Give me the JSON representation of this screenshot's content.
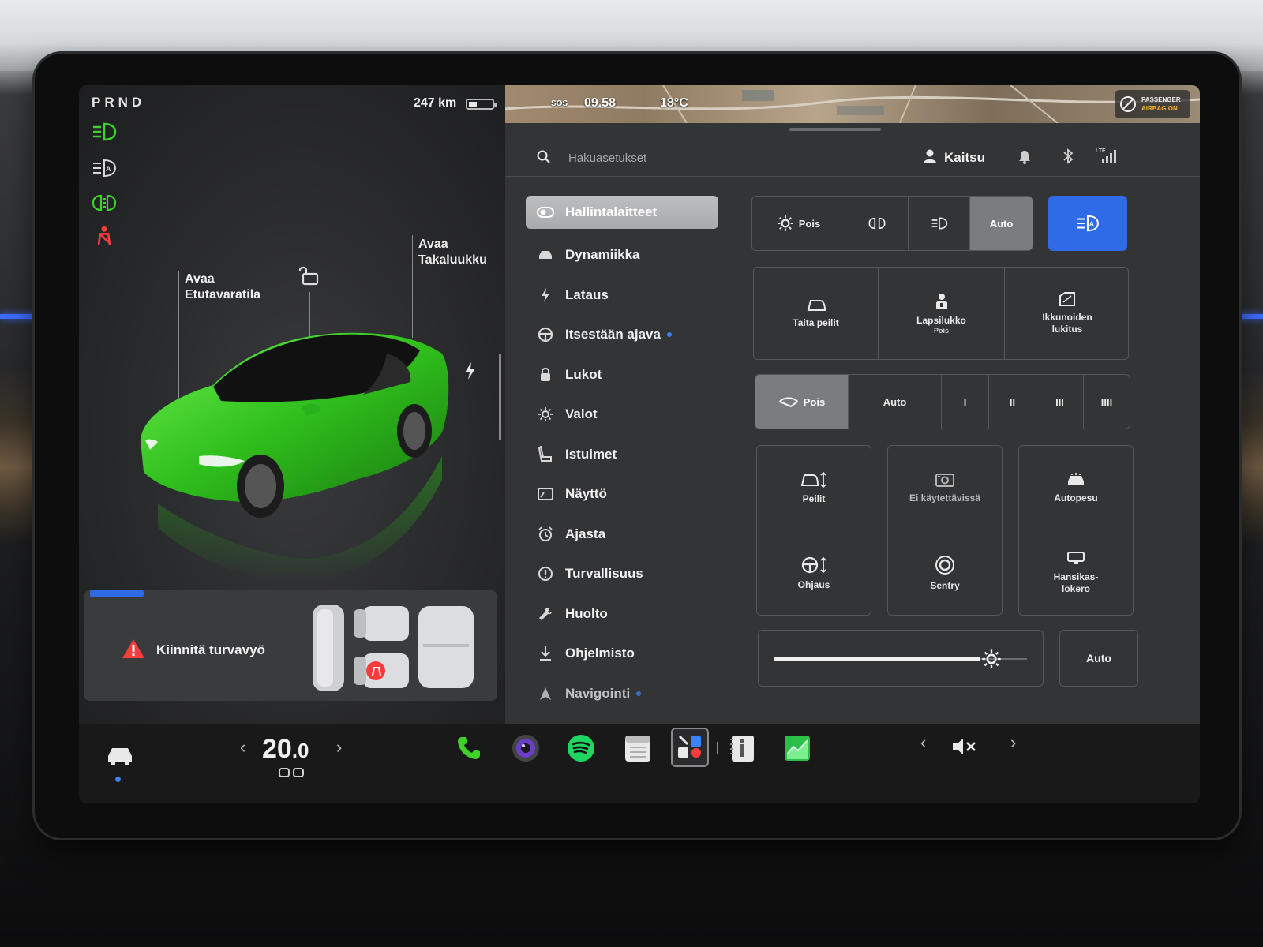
{
  "status": {
    "gear": "PRND",
    "range": "247 km",
    "map_time": "09.58",
    "map_temp": "18°C",
    "map_badge": "SOS",
    "airbag_line1": "PASSENGER",
    "airbag_line2": "AIRBAG ON"
  },
  "car": {
    "frunk_label_1": "Avaa",
    "frunk_label_2": "Etutavaratila",
    "trunk_label_1": "Avaa",
    "trunk_label_2": "Takaluukku",
    "body_color": "#3fd22b"
  },
  "alert": {
    "text": "Kiinnitä turvavyö"
  },
  "topbar": {
    "search_placeholder": "Hakuasetukset",
    "profile_name": "Kaitsu",
    "signal": "LTE"
  },
  "menu": [
    {
      "label": "Hallintalaitteet",
      "icon": "toggle-icon"
    },
    {
      "label": "Dynamiikka",
      "icon": "car-icon"
    },
    {
      "label": "Lataus",
      "icon": "bolt-icon"
    },
    {
      "label": "Itsestään ajava",
      "icon": "steering-wheel-icon"
    },
    {
      "label": "Lukot",
      "icon": "lock-icon"
    },
    {
      "label": "Valot",
      "icon": "sun-icon"
    },
    {
      "label": "Istuimet",
      "icon": "seat-icon"
    },
    {
      "label": "Näyttö",
      "icon": "display-icon"
    },
    {
      "label": "Ajasta",
      "icon": "alarm-clock-icon"
    },
    {
      "label": "Turvallisuus",
      "icon": "info-circle-icon"
    },
    {
      "label": "Huolto",
      "icon": "wrench-icon"
    },
    {
      "label": "Ohjelmisto",
      "icon": "download-icon"
    },
    {
      "label": "Navigointi",
      "icon": "navigation-icon"
    }
  ],
  "lights": {
    "off_label": "Pois",
    "auto_label": "Auto"
  },
  "tiles_row1": [
    {
      "label": "Taita peilit",
      "sub": ""
    },
    {
      "label": "Lapsilukko",
      "sub": "Pois"
    },
    {
      "label_1": "Ikkunoiden",
      "label_2": "lukitus"
    }
  ],
  "wipers": {
    "off_label": "Pois",
    "auto_label": "Auto",
    "speeds": [
      "I",
      "II",
      "III",
      "IIII"
    ]
  },
  "tiles_grid": [
    {
      "label": "Peilit"
    },
    {
      "label": "Ei käytettävissä"
    },
    {
      "label": "Autopesu"
    },
    {
      "label": "Ohjaus"
    },
    {
      "label": "Sentry"
    },
    {
      "label_1": "Hansikas-",
      "label_2": "lokero"
    }
  ],
  "brightness": {
    "level": 0.86,
    "auto_label": "Auto"
  },
  "dock": {
    "temperature_int": "20",
    "temperature_dec": ".0"
  }
}
